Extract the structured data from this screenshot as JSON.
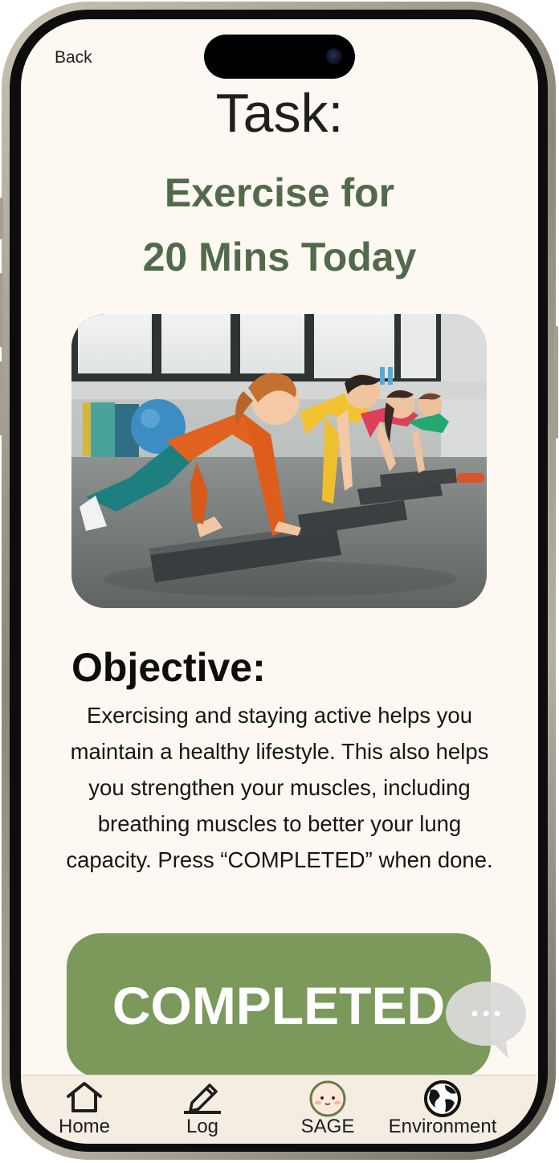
{
  "header": {
    "back_label": "Back",
    "task_heading": "Task:",
    "task_title_line1": "Exercise for",
    "task_title_line2": "20 Mins Today"
  },
  "objective": {
    "heading": "Objective:",
    "text": "Exercising and staying active helps you maintain a healthy lifestyle. This also helps you strengthen your muscles, including breathing muscles to better your lung capacity. Press “COMPLETED” when done."
  },
  "actions": {
    "completed_label": "COMPLETED"
  },
  "bottom_nav": {
    "items": [
      {
        "label": "Home",
        "icon": "home-icon"
      },
      {
        "label": "Log",
        "icon": "pencil-icon"
      },
      {
        "label": "SAGE",
        "icon": "sage-avatar-icon"
      },
      {
        "label": "Environment",
        "icon": "globe-icon"
      }
    ]
  },
  "colors": {
    "screen_background": "#fdf8f2",
    "title_green": "#516a4c",
    "button_green": "#7b995b",
    "nav_background": "#f4ede2"
  }
}
